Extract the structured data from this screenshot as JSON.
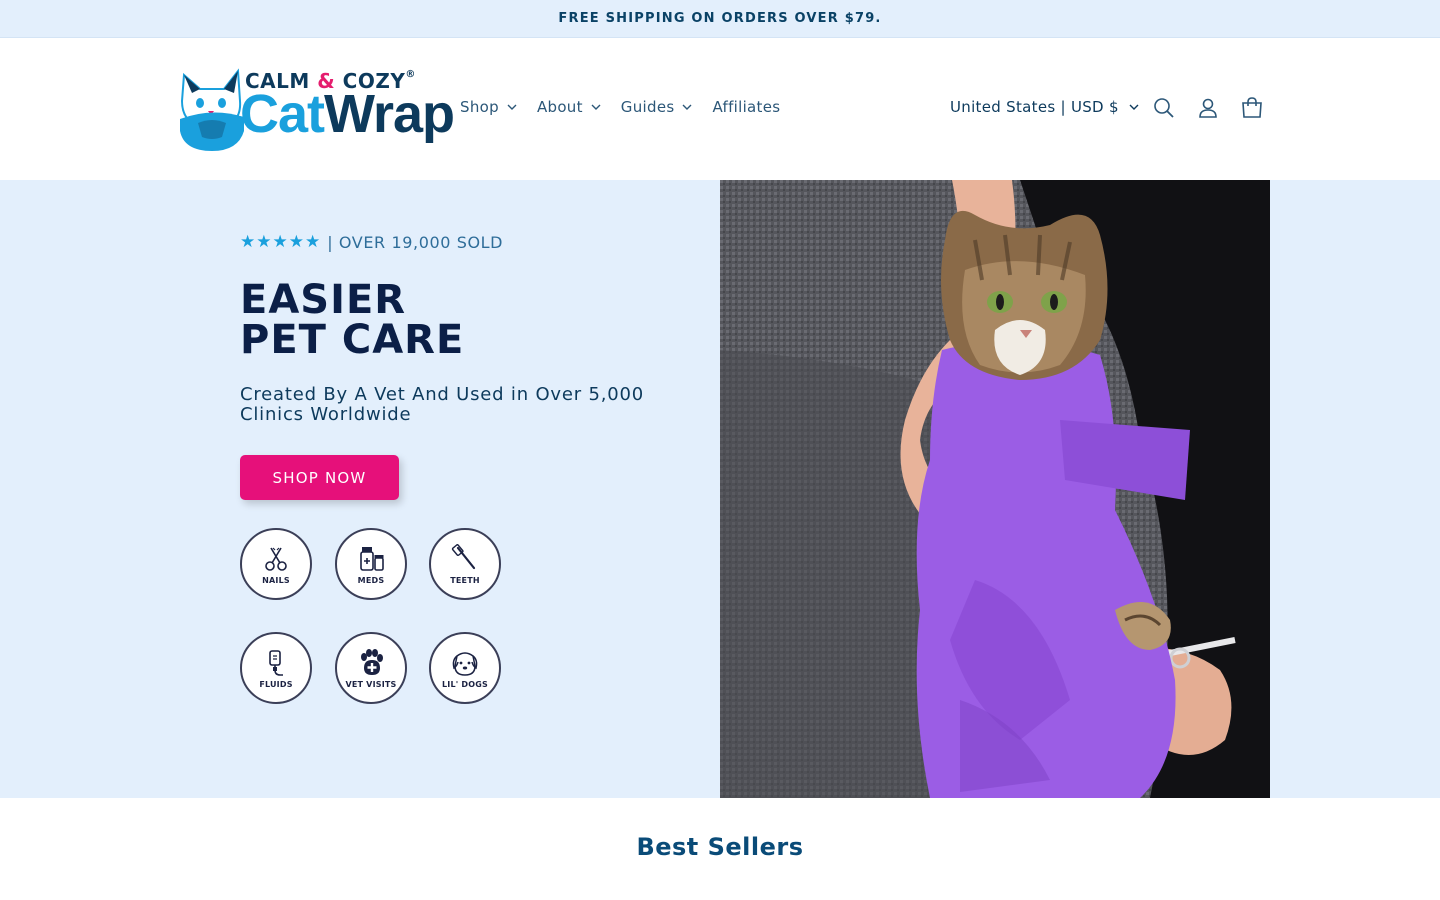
{
  "announcement": {
    "text": "FREE SHIPPING ON ORDERS OVER $79."
  },
  "logo": {
    "line1_a": "CALM ",
    "line1_amp": "&",
    "line1_b": " COZY",
    "reg": "®",
    "main_a": "Cat",
    "main_b": "Wrap"
  },
  "nav": {
    "items": [
      {
        "label": "Shop",
        "has_dropdown": true
      },
      {
        "label": "About",
        "has_dropdown": true
      },
      {
        "label": "Guides",
        "has_dropdown": true
      },
      {
        "label": "Affiliates",
        "has_dropdown": false
      }
    ]
  },
  "header": {
    "country_label": "United States | USD $",
    "icons": [
      "search-icon",
      "account-icon",
      "cart-icon"
    ]
  },
  "hero": {
    "stars": "★★★★★",
    "rating_text": "| OVER 19,000 SOLD",
    "title_line1": "EASIER",
    "title_line2": "PET CARE",
    "subtitle": "Created By A Vet And Used in Over 5,000 Clinics Worldwide",
    "cta_label": "SHOP NOW",
    "badges": [
      {
        "label": "NAILS",
        "icon": "nail-clipper-icon"
      },
      {
        "label": "MEDS",
        "icon": "medicine-icon"
      },
      {
        "label": "TEETH",
        "icon": "toothbrush-icon"
      },
      {
        "label": "FLUIDS",
        "icon": "iv-bag-icon"
      },
      {
        "label": "VET VISITS",
        "icon": "paw-cross-icon"
      },
      {
        "label": "LIL' DOGS",
        "icon": "dog-face-icon"
      }
    ]
  },
  "colors": {
    "accent_pink": "#e6107a",
    "brand_blue": "#1aa0dd",
    "navy": "#0b1f47",
    "hero_bg": "#e3effc",
    "wrap_purple": "#9b5de5"
  },
  "sections": {
    "best_sellers_title": "Best Sellers"
  }
}
